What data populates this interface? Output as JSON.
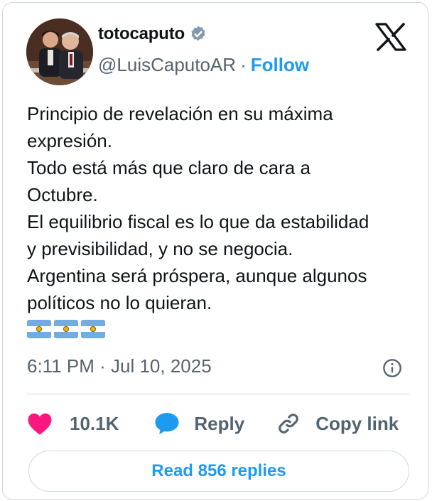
{
  "author": {
    "display_name": "totocaputo",
    "handle": "@LuisCaputoAR",
    "separator": "·",
    "follow_label": "Follow"
  },
  "tweet": {
    "text": "Principio de revelación en su máxima\nexpresión.\nTodo está más que claro de cara a\nOctubre.\nEl equilibrio fiscal es lo que da estabilidad\ny previsibilidad, y no se negocia.\nArgentina será próspera, aunque algunos\npolíticos no lo quieran.",
    "emoji_flags": [
      "argentina-flag",
      "argentina-flag",
      "argentina-flag"
    ],
    "timestamp": "6:11 PM · Jul 10, 2025"
  },
  "actions": {
    "like_count": "10.1K",
    "reply_label": "Reply",
    "copy_label": "Copy link"
  },
  "read_replies_label": "Read 856 replies",
  "icons": {
    "verified": "verified-badge-icon",
    "x_logo": "x-logo-icon",
    "info": "info-icon",
    "like": "heart-icon",
    "reply": "speech-bubble-icon",
    "copy": "link-icon"
  },
  "colors": {
    "accent": "#1d9bf0",
    "like": "#f91880",
    "muted": "#536471",
    "border": "#cfd9de",
    "text": "#0f1419"
  }
}
